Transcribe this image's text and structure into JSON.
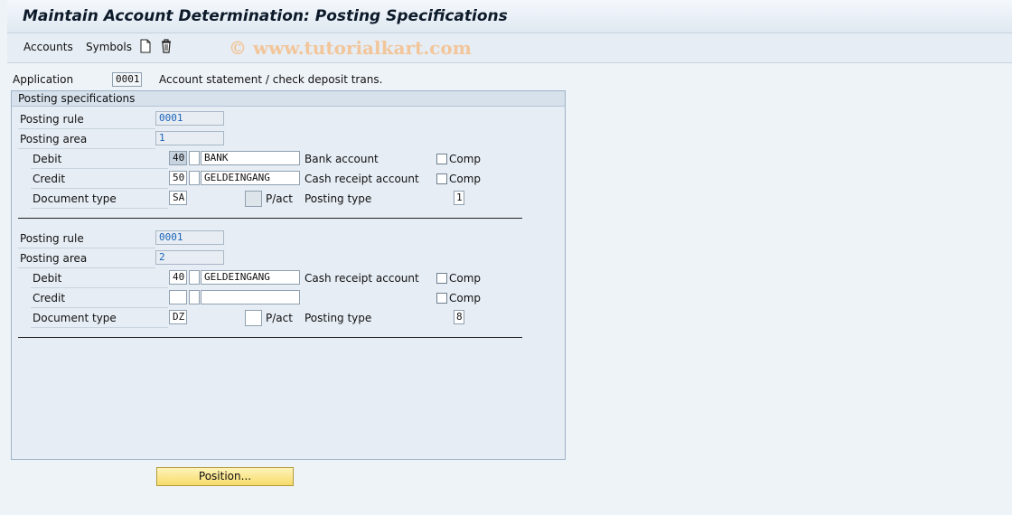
{
  "window": {
    "title": "Maintain Account Determination: Posting Specifications"
  },
  "toolbar": {
    "accounts": "Accounts",
    "symbols": "Symbols",
    "watermark": "© www.tutorialkart.com",
    "icons": [
      "new-document-icon",
      "delete-trash-icon"
    ]
  },
  "header": {
    "application_label": "Application",
    "application_value": "0001",
    "application_desc": "Account statement / check deposit trans."
  },
  "group": {
    "title": "Posting specifications"
  },
  "labels": {
    "posting_rule": "Posting rule",
    "posting_area": "Posting area",
    "debit": "Debit",
    "credit": "Credit",
    "document_type": "Document type",
    "pact": "P/act",
    "posting_type": "Posting type",
    "comp": "Comp"
  },
  "blocks": [
    {
      "posting_rule": "0001",
      "posting_area": "1",
      "debit": {
        "key": "40",
        "flag": "",
        "account": "BANK",
        "desc": "Bank account"
      },
      "credit": {
        "key": "50",
        "flag": "",
        "account": "GELDEINGANG",
        "desc": "Cash receipt account"
      },
      "document_type": "SA",
      "posting_type": "1"
    },
    {
      "posting_rule": "0001",
      "posting_area": "2",
      "debit": {
        "key": "40",
        "flag": "",
        "account": "GELDEINGANG",
        "desc": "Cash receipt account"
      },
      "credit": {
        "key": "",
        "flag": "",
        "account": "",
        "desc": ""
      },
      "document_type": "DZ",
      "posting_type": "8"
    }
  ],
  "footer": {
    "position_button": "Position..."
  }
}
